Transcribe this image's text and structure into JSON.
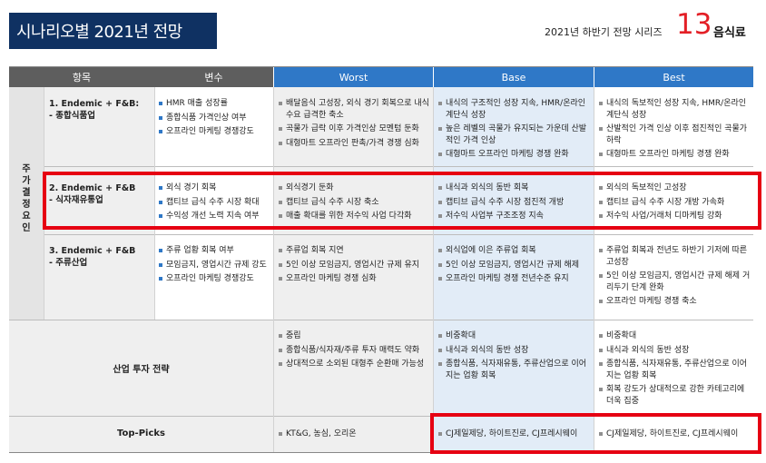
{
  "header": {
    "title": "시나리오별 2021년 전망",
    "series_label": "2021년 하반기 전망 시리즈",
    "series_number": "13",
    "series_topic": "음식료"
  },
  "table": {
    "columns": [
      "항목",
      "변수",
      "Worst",
      "Base",
      "Best"
    ],
    "side_label": "주가결정요인",
    "rows": [
      {
        "title_line1": "1. Endemic + F&B:",
        "title_line2": "- 종합식품업",
        "variables": [
          "HMR 매출 성장률",
          "종합식품 가격인상 여부",
          "오프라인 마케팅 경쟁강도"
        ],
        "worst": [
          "배달음식 고성장, 외식 경기 회복으로 내식 수요 급격한 축소",
          "곡물가 급락 이후 가격인상 모멘텀 둔화",
          "대형마트 오프라인 판촉/가격 경쟁 심화"
        ],
        "base": [
          "내식의 구조적인 성장 지속, HMR/온라인 계단식 성장",
          "높은 레벨의 곡물가 유지되는 가운데 산발적인 가격 인상",
          "대형마트 오프라인 마케팅 경쟁 완화"
        ],
        "best": [
          "내식의 독보적인 성장 지속, HMR/온라인 계단식 성장",
          "산발적인 가격 인상 이후 점진적인 곡물가 하락",
          "대형마트 오프라인 마케팅 경쟁 완화"
        ]
      },
      {
        "title_line1": "2. Endemic + F&B",
        "title_line2": "- 식자재유통업",
        "variables": [
          "외식 경기 회복",
          "캡티브 급식 수주 시장 확대",
          "수익성 개선 노력 지속 여부"
        ],
        "worst": [
          "외식경기 둔화",
          "캡티브 급식 수주 시장 축소",
          "매출 확대를 위한 저수익 사업 다각화"
        ],
        "base": [
          "내식과 외식의 동반 회복",
          "캡티브 급식 수주 시장 점진적 개방",
          "저수익 사업부 구조조정 지속"
        ],
        "best": [
          "외식의 독보적인 고성장",
          "캡티브 급식 수주 시장 개방 가속화",
          "저수익 사업/거래처 디마케팅 강화"
        ]
      },
      {
        "title_line1": "3. Endemic + F&B",
        "title_line2": "- 주류산업",
        "variables": [
          "주류 업황 회복 여부",
          "모임금지, 영업시간 규제 강도",
          "오프라인 마케팅 경쟁강도"
        ],
        "worst": [
          "주류업 회복 지연",
          "5인 이상 모임금지, 영업시간 규제 유지",
          "오프라인 마케팅 경쟁 심화"
        ],
        "base": [
          "외식업에 이은 주류업 회복",
          "5인 이상 모임금지, 영업시간 규제 해제",
          "오프라인 마케팅 경쟁 전년수준 유지"
        ],
        "best": [
          "주류업 회복과 전년도 하반기 기저에 따른 고성장",
          "5인 이상 모임금지, 영업시간 규제 해제 거리두기 단계 완화",
          "오프라인 마케팅 경쟁 축소"
        ]
      }
    ],
    "strategy": {
      "label": "산업 투자 전략",
      "worst": [
        "중립",
        "종합식품/식자재/주류 투자 매력도 약화",
        "상대적으로 소외된 대형주 순환매 가능성"
      ],
      "base": [
        "비중확대",
        "내식과 외식의 동반 성장",
        "종합식품, 식자재유통, 주류산업으로 이어지는 업황 회복"
      ],
      "best": [
        "비중확대",
        "내식과 외식의 동반 성장",
        "종합식품, 식자재유통, 주류산업으로 이어지는 업황 회복",
        "회복 강도가 상대적으로 강한 카테고리에 더욱 집중"
      ]
    },
    "top_picks": {
      "label": "Top-Picks",
      "worst": [
        "KT&G, 농심, 오리온"
      ],
      "base": [
        "CJ제일제당, 하이트진로, CJ프레시웨이"
      ],
      "best": [
        "CJ제일제당, 하이트진로, CJ프레시웨이"
      ]
    }
  },
  "colors": {
    "title_bg": "#0f3162",
    "header_dark": "#5e5e5e",
    "header_blue": "#2f78c7",
    "base_bg": "#e2ecf7",
    "highlight_red": "#e60012",
    "series_number": "#e31f26"
  }
}
